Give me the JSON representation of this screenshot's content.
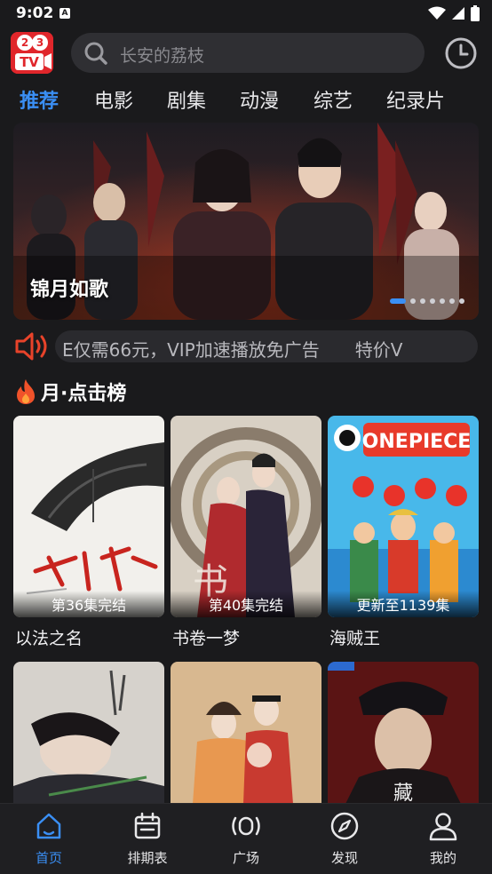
{
  "status": {
    "time": "9:02",
    "a_badge": "A"
  },
  "header": {
    "logo_text_top": "2 3",
    "logo_text_bottom": "TV",
    "search_placeholder": "长安的荔枝"
  },
  "tabs": [
    {
      "label": "推荐",
      "active": true
    },
    {
      "label": "电影"
    },
    {
      "label": "剧集"
    },
    {
      "label": "动漫"
    },
    {
      "label": "综艺"
    },
    {
      "label": "纪录片"
    }
  ],
  "banner": {
    "title": "锦月如歌",
    "dots_total": 7,
    "active_dot": 0
  },
  "notice": {
    "text": "E仅需66元，VIP加速播放免广告　　特价V"
  },
  "section": {
    "title": "月·点击榜"
  },
  "cards": [
    {
      "title": "以法之名",
      "badge": "第36集完结"
    },
    {
      "title": "书卷一梦",
      "badge": "第40集完结"
    },
    {
      "title": "海贼王",
      "badge": "更新至1139集"
    }
  ],
  "nav": [
    {
      "label": "首页",
      "icon": "home-icon",
      "active": true
    },
    {
      "label": "排期表",
      "icon": "calendar-icon"
    },
    {
      "label": "广场",
      "icon": "broadcast-icon"
    },
    {
      "label": "发现",
      "icon": "compass-icon"
    },
    {
      "label": "我的",
      "icon": "user-icon"
    }
  ],
  "colors": {
    "accent": "#3a8ff5",
    "brand": "#e0262b",
    "background": "#1a1a1c"
  }
}
